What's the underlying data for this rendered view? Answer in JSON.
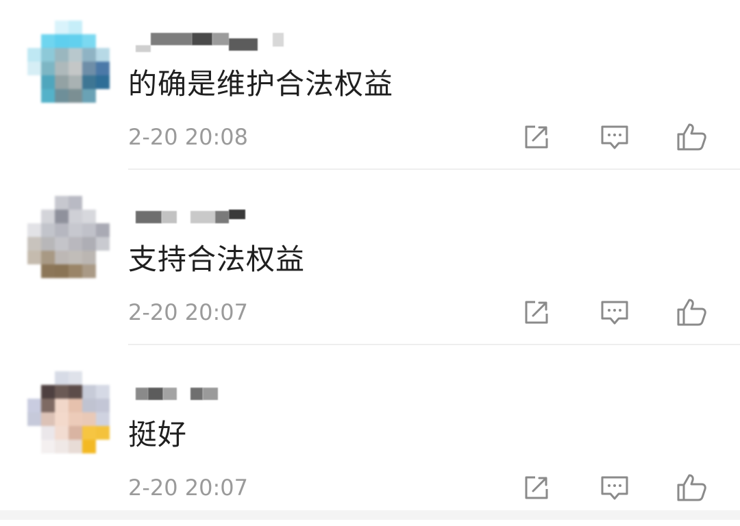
{
  "comments": [
    {
      "text": "的确是维护合法权益",
      "time": "2-20 20:08"
    },
    {
      "text": "支持合法权益",
      "time": "2-20 20:07"
    },
    {
      "text": "挺好",
      "time": "2-20 20:07"
    }
  ],
  "icons": {
    "share": "share-icon",
    "reply": "comment-icon",
    "like": "thumbs-up-icon"
  },
  "colors": {
    "text": "#1f1f1f",
    "timestamp": "#9a9a9a",
    "icon": "#8a8a8a",
    "divider": "#eeeeee"
  }
}
